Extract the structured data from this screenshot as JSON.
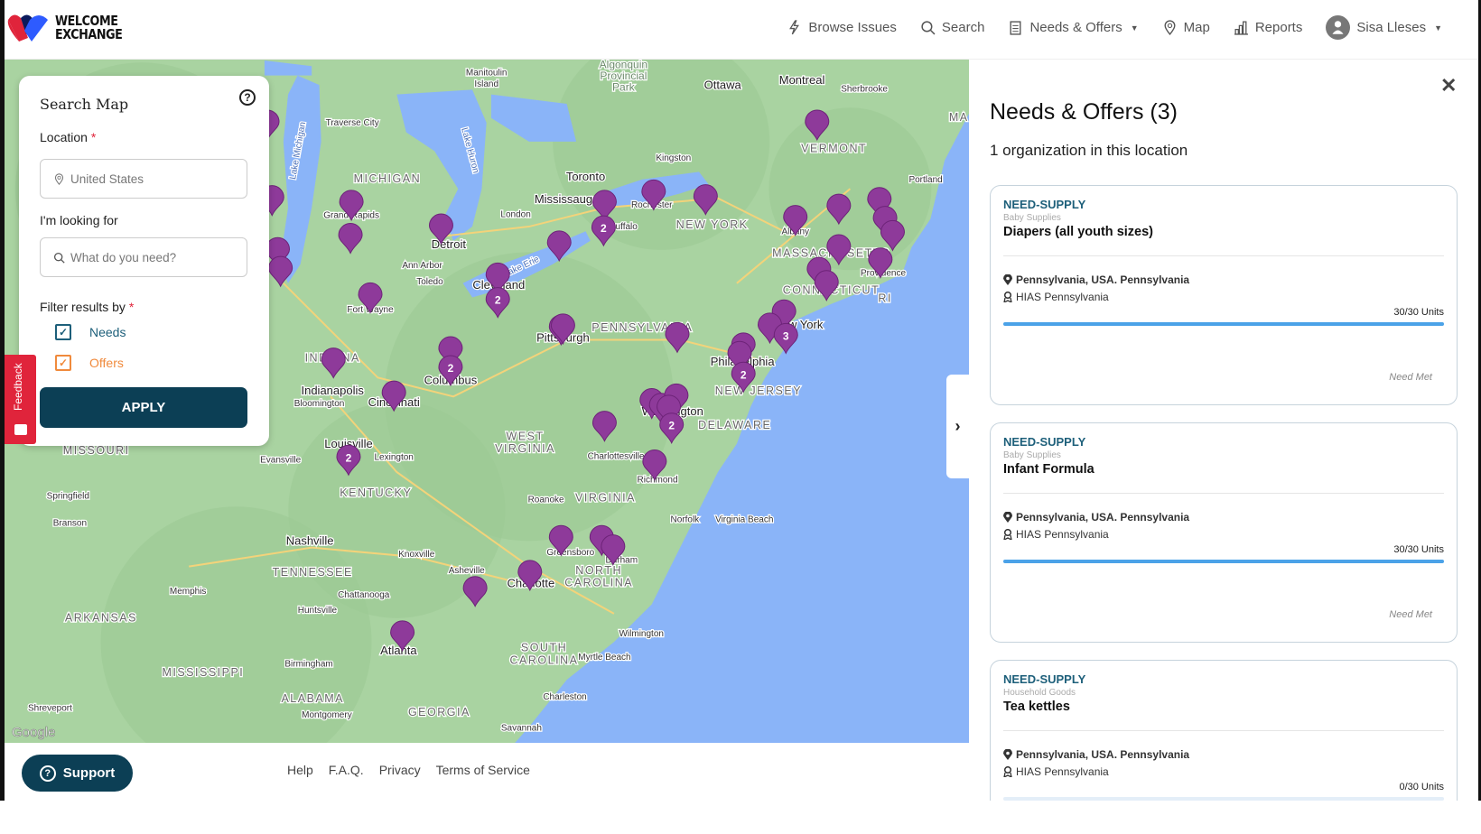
{
  "header": {
    "logo_text_1": "WELCOME",
    "logo_text_2": "EXCHANGE",
    "nav": [
      {
        "label": "Browse Issues",
        "icon": "lightning-icon"
      },
      {
        "label": "Search",
        "icon": "search-icon"
      },
      {
        "label": "Needs & Offers",
        "icon": "clipboard-icon"
      },
      {
        "label": "Map",
        "icon": "map-pin-icon"
      },
      {
        "label": "Reports",
        "icon": "bar-chart-icon"
      }
    ],
    "user_name": "Sisa Lleses"
  },
  "search_panel": {
    "title": "Search Map",
    "help": "?",
    "location_label": "Location",
    "required_mark": "*",
    "location_value": "United States",
    "looking_for_label": "I'm looking for",
    "looking_for_placeholder": "What do you need?",
    "filter_label": "Filter results by",
    "filters": [
      {
        "label": "Needs",
        "checked": true,
        "color": "#1d5f7a"
      },
      {
        "label": "Offers",
        "checked": true,
        "color": "#f08a3c"
      }
    ],
    "apply_label": "APPLY"
  },
  "feedback_label": "Feedback",
  "map": {
    "marker_color": "#8e3a9a",
    "cluster_counts": [
      "2",
      "2",
      "2",
      "2",
      "2",
      "3",
      "2",
      "2"
    ],
    "google_label": "Google",
    "labels": [
      "MICHIGAN",
      "Detroit",
      "Toronto",
      "Ottawa",
      "Montreal",
      "VERMONT",
      "NEW YORK",
      "Albany",
      "Rochester",
      "Kingston",
      "London",
      "Cleveland",
      "Toledo",
      "Ann Arbor",
      "Fort Wayne",
      "Pittsburgh",
      "PENNSYLVANIA",
      "Columbus",
      "Indianapolis",
      "Cincinnati",
      "INDIANA",
      "Louisville",
      "Lexington",
      "KENTUCKY",
      "WEST",
      "VIRGINIA",
      "VIRGINIA",
      "Charlottesville",
      "Richmond",
      "Roanoke",
      "Norfolk",
      "Virginia Beach",
      "Washington",
      "Philadelphia",
      "NEW JERSEY",
      "DELAWARE",
      "New York",
      "CONNECTICUT",
      "MASSACHUSETTS",
      "Providence",
      "Portland",
      "Sherbrooke",
      "Nashville",
      "Knoxville",
      "TENNESSEE",
      "Chattanooga",
      "Memphis",
      "ARKANSAS",
      "MISSISSIPPI",
      "Huntsville",
      "Birmingham",
      "ALABAMA",
      "Montgomery",
      "Atlanta",
      "GEORGIA",
      "Charlotte",
      "NORTH",
      "CAROLINA",
      "Greensboro",
      "Durham",
      "Asheville",
      "SOUTH",
      "CAROLINA",
      "Wilmington",
      "Myrtle Beach",
      "Charleston",
      "Savannah",
      "MISSOURI",
      "Springfield",
      "Branson",
      "Evansville",
      "Bloomington",
      "Shreveport",
      "Traverse City",
      "Grand Rapids",
      "Algonquin",
      "Provincial",
      "Park",
      "Manitoulin",
      "Island",
      "Lake Michigan",
      "Lake Huron",
      "Lake Erie",
      "Mississauga",
      "Buffalo",
      "RI",
      "MA"
    ]
  },
  "panel": {
    "title": "Needs & Offers (3)",
    "subtitle": "1 organization in this location",
    "items": [
      {
        "type": "NEED-SUPPLY",
        "category": "Baby Supplies",
        "title": "Diapers (all youth sizes)",
        "location": "Pennsylvania, USA. Pennsylvania",
        "org": "HIAS Pennsylvania",
        "units": "30/30 Units",
        "progress": 1.0,
        "status": "Need Met"
      },
      {
        "type": "NEED-SUPPLY",
        "category": "Baby Supplies",
        "title": "Infant Formula",
        "location": "Pennsylvania, USA. Pennsylvania",
        "org": "HIAS Pennsylvania",
        "units": "30/30 Units",
        "progress": 1.0,
        "status": "Need Met"
      },
      {
        "type": "NEED-SUPPLY",
        "category": "Household Goods",
        "title": "Tea kettles",
        "location": "Pennsylvania, USA. Pennsylvania",
        "org": "HIAS Pennsylvania",
        "units": "0/30 Units",
        "progress": 0.0,
        "status": ""
      }
    ]
  },
  "footer": {
    "support_label": "Support",
    "links": [
      "Help",
      "F.A.Q.",
      "Privacy",
      "Terms of Service"
    ]
  }
}
